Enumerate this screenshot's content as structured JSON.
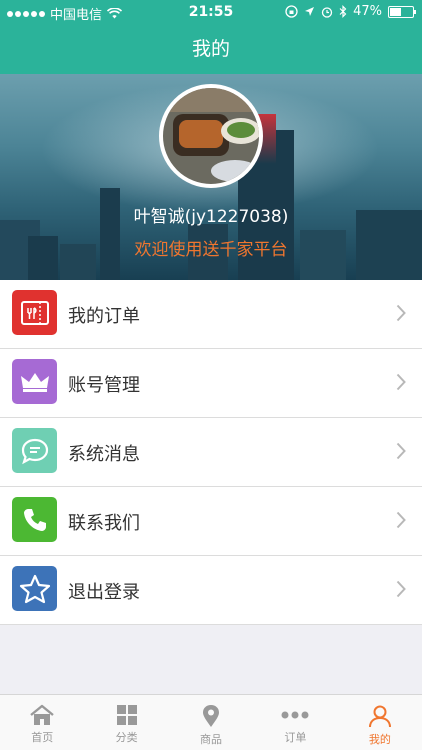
{
  "status_bar": {
    "carrier": "中国电信",
    "time": "21:55",
    "battery": "47%"
  },
  "nav": {
    "title": "我的"
  },
  "profile": {
    "username": "叶智诚(jy1227038)",
    "welcome": "欢迎使用送千家平台"
  },
  "menu": {
    "items": [
      {
        "label": "我的订单",
        "icon": "order-ticket-icon",
        "color": "#e0322f"
      },
      {
        "label": "账号管理",
        "icon": "crown-icon",
        "color": "#a66ad4"
      },
      {
        "label": "系统消息",
        "icon": "chat-bubble-icon",
        "color": "#6fcfb3"
      },
      {
        "label": "联系我们",
        "icon": "phone-icon",
        "color": "#4cb833"
      },
      {
        "label": "退出登录",
        "icon": "star-icon",
        "color": "#3d73b8"
      }
    ]
  },
  "tab_bar": {
    "tabs": [
      {
        "label": "首页",
        "icon": "home-icon"
      },
      {
        "label": "分类",
        "icon": "grid-icon"
      },
      {
        "label": "商品",
        "icon": "location-pin-icon"
      },
      {
        "label": "订单",
        "icon": "more-dots-icon"
      },
      {
        "label": "我的",
        "icon": "person-icon",
        "active": true
      }
    ],
    "colors": {
      "active": "#f0762f",
      "inactive": "#999999"
    }
  },
  "theme": {
    "primary": "#2bb39a",
    "accent": "#f0762f"
  }
}
